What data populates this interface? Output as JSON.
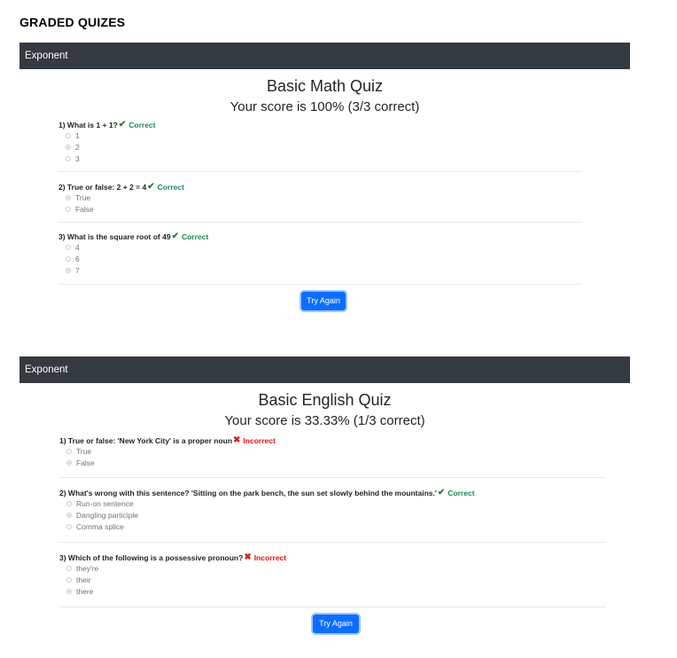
{
  "page": {
    "title": "GRADED QUIZES"
  },
  "quizzes": [
    {
      "header": "Exponent",
      "title": "Basic Math Quiz",
      "score": "Your score is 100% (3/3 correct)",
      "button": "Try Again",
      "questions": [
        {
          "text": "1) What is 1 + 1?",
          "result": "Correct",
          "mark": "check-icon",
          "options": [
            "1",
            "2",
            "3"
          ],
          "selected": 1
        },
        {
          "text": "2) True or false: 2 + 2 = 4",
          "result": "Correct",
          "mark": "check-icon",
          "options": [
            "True",
            "False"
          ],
          "selected": 0
        },
        {
          "text": "3) What is the square root of 49",
          "result": "Correct",
          "mark": "check-icon",
          "options": [
            "4",
            "6",
            "7"
          ],
          "selected": 2
        }
      ]
    },
    {
      "header": "Exponent",
      "title": "Basic English Quiz",
      "score": "Your score is 33.33% (1/3 correct)",
      "button": "Try Again",
      "questions": [
        {
          "text": "1) True or false: 'New York City' is a proper noun",
          "result": "Incorrect",
          "mark": "cross-icon",
          "options": [
            "True",
            "False"
          ],
          "selected": 1
        },
        {
          "text": "2) What's wrong with this sentence? 'Sitting on the park bench, the sun set slowly behind the mountains.'",
          "result": "Correct",
          "mark": "check-icon",
          "options": [
            "Run-on sentence",
            "Dangling participle",
            "Comma splice"
          ],
          "selected": 1
        },
        {
          "text": "3) Which of the following is a possessive pronoun?",
          "result": "Incorrect",
          "mark": "cross-icon",
          "options": [
            "they're",
            "their",
            "there"
          ],
          "selected": 2
        }
      ]
    }
  ],
  "colors": {
    "header_bg": "#343a40",
    "correct": "#198754",
    "incorrect": "#e3110e",
    "button": "#0d6efd"
  }
}
